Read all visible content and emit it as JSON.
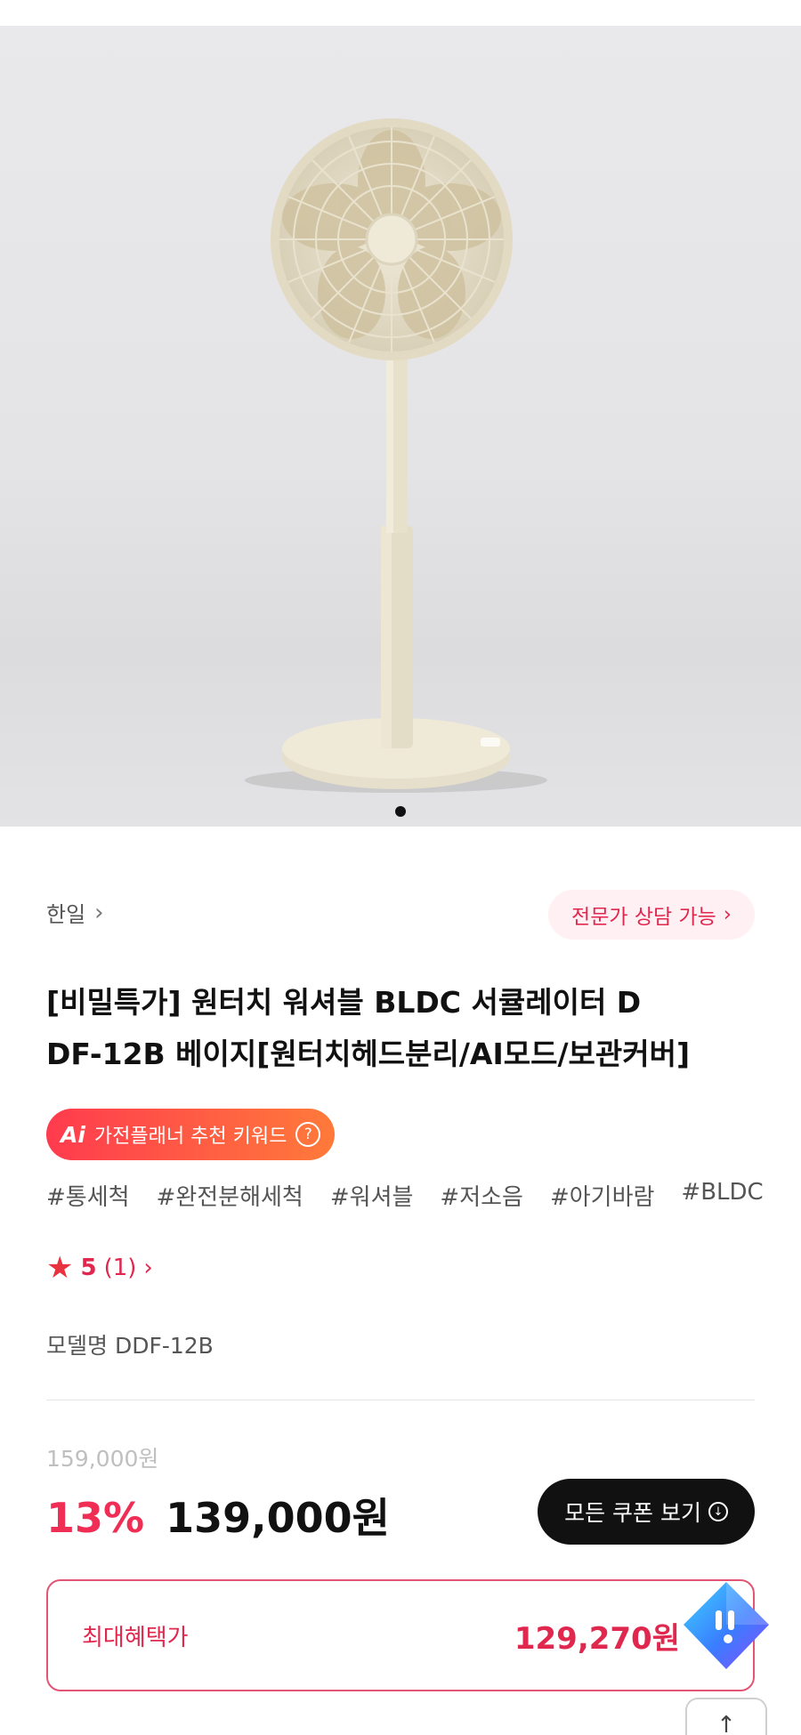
{
  "gallery": {
    "image_alt": "stand fan product image",
    "dots": [
      true,
      false,
      false
    ]
  },
  "brand": {
    "name": "한일",
    "chevron": "›"
  },
  "consult": {
    "label": "전문가 상담 가능",
    "chevron": "›"
  },
  "product": {
    "title_line1": "[비밀특가] 원터치 워셔블 BLDC 서큘레이터 D",
    "title_line2": "DF-12B 베이지[원터치헤드분리/AI모드/보관커버]"
  },
  "ai_planner": {
    "logo": "Ai",
    "label": "가전플래너 추천 키워드",
    "help": "?"
  },
  "tags": [
    "#통세척",
    "#완전분해세척",
    "#워셔블",
    "#저소음",
    "#아기바람",
    "#BLDC"
  ],
  "rating": {
    "star": "★",
    "score": "5",
    "count": "(1)",
    "chevron": "›"
  },
  "model": {
    "text": "모델명 DDF-12B"
  },
  "pricing": {
    "original": "159,000원",
    "discount": "13%",
    "price": "139,000원",
    "coupon_button": "모든 쿠폰 보기",
    "coupon_icon": "download-icon"
  },
  "benefit": {
    "label": "최대혜택가",
    "price": "129,270원"
  },
  "floating": {
    "gem_icon": "chat-gem-icon",
    "scroll_top_icon": "arrow-up-icon",
    "scroll_top_glyph": "↑"
  }
}
